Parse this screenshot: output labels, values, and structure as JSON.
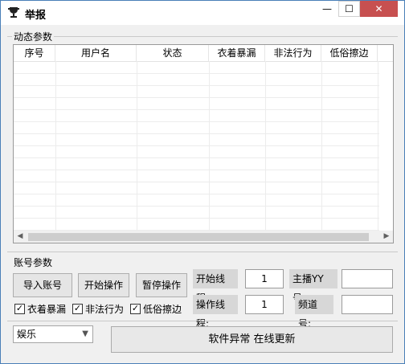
{
  "window": {
    "title": "举报"
  },
  "sections": {
    "dynamic_params": "动态参数",
    "account_params": "账号参数"
  },
  "table": {
    "columns": [
      "序号",
      "用户名",
      "状态",
      "衣着暴漏",
      "非法行为",
      "低俗擦边"
    ]
  },
  "buttons": {
    "import": "导入账号",
    "start": "开始操作",
    "pause": "暂停操作"
  },
  "fields": {
    "start_threads_label": "开始线程:",
    "start_threads_value": "1",
    "op_threads_label": "操作线程:",
    "op_threads_value": "1",
    "host_label": "主播YY号:",
    "host_value": "",
    "channel_label": "频道号:",
    "channel_value": ""
  },
  "checkboxes": [
    {
      "label": "衣着暴漏",
      "checked": true
    },
    {
      "label": "非法行为",
      "checked": true
    },
    {
      "label": "低俗擦边",
      "checked": true
    }
  ],
  "category_select": "娱乐",
  "status_text": "软件异常  在线更新",
  "icons": {
    "app": "trophy-icon",
    "min": "minimize-icon",
    "max": "maximize-icon",
    "close": "close-icon"
  }
}
